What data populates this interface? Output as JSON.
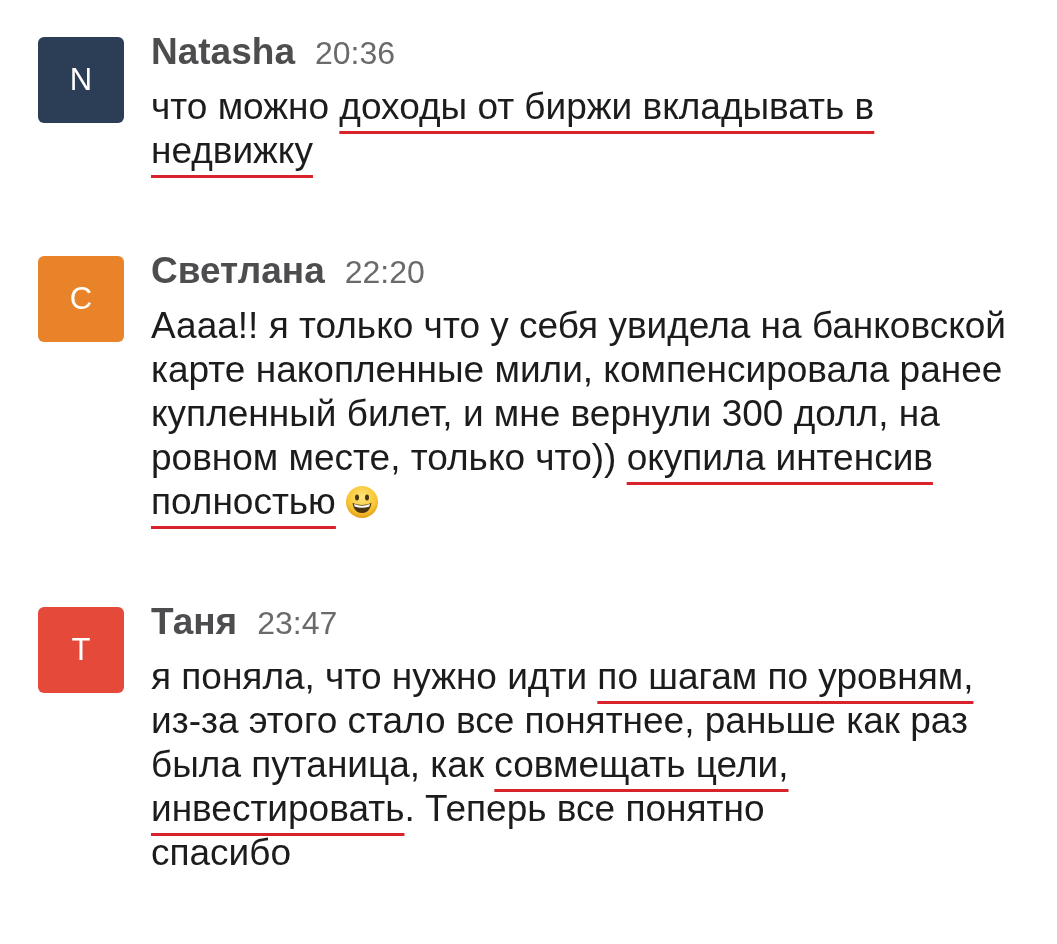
{
  "messages": [
    {
      "author": "Natasha",
      "initial": "N",
      "color": "#2c3e55",
      "time": "20:36",
      "segments": [
        {
          "text": "что можно ",
          "underlined": false
        },
        {
          "text": "доходы от биржи вкладывать в недвижку",
          "underlined": true
        }
      ]
    },
    {
      "author": "Светлана",
      "initial": "С",
      "color": "#e8832a",
      "time": "22:20",
      "segments": [
        {
          "text": "Аааа!! я только что у себя увидела на банковской карте накопленные мили, компенсировала ранее купленный билет, и мне вернули 300 долл, на ровном месте, только что)) ",
          "underlined": false
        },
        {
          "text": "окупила интенсив полностью",
          "underlined": true
        }
      ],
      "emoji": true
    },
    {
      "author": "Таня",
      "initial": "Т",
      "color": "#e5493a",
      "time": "23:47",
      "segments": [
        {
          "text": "я поняла, что нужно идти ",
          "underlined": false
        },
        {
          "text": "по шагам по уровням,",
          "underlined": true
        },
        {
          "text": " из-за этого стало все понятнее, раньше как раз была путаница, как ",
          "underlined": false
        },
        {
          "text": "совмещать цели, инвестировать",
          "underlined": true
        },
        {
          "text": ". Теперь все понятно\nспасибо",
          "underlined": false
        }
      ]
    }
  ]
}
